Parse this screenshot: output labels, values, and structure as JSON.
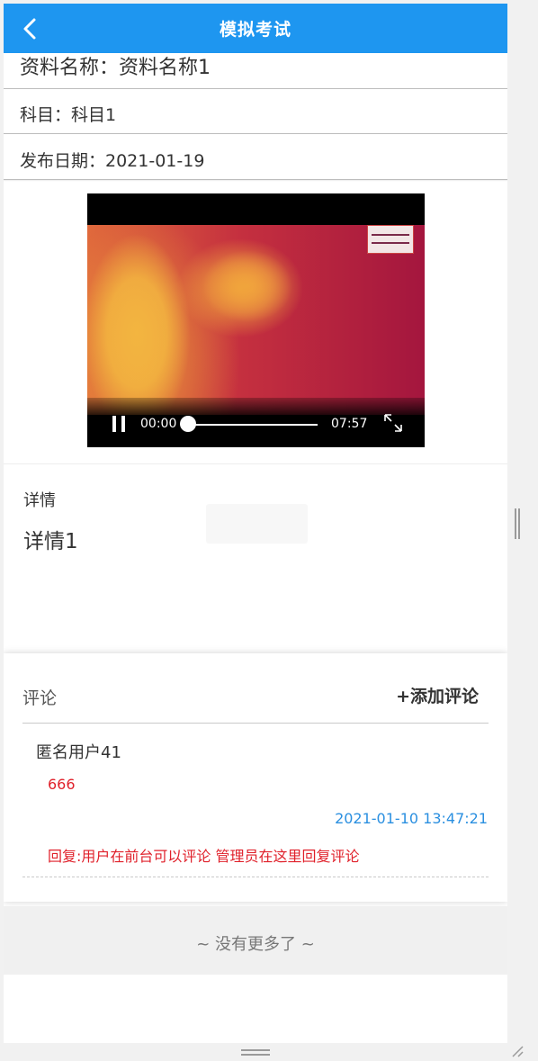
{
  "header": {
    "title": "模拟考试",
    "back_icon": "chevron-left-icon"
  },
  "info": {
    "name": "资料名称：资料名称1",
    "subject": "科目：科目1",
    "publish_date": "发布日期：2021-01-19"
  },
  "video": {
    "current_time": "00:00",
    "total_time": "07:57",
    "progress": 0,
    "state": "playing",
    "pause_icon": "pause-icon",
    "fullscreen_icon": "fullscreen-icon"
  },
  "detail": {
    "label": "详情",
    "text": "详情1"
  },
  "comments": {
    "label": "评论",
    "add_label": "+添加评论",
    "items": [
      {
        "user": "匿名用户41",
        "content": "666",
        "time": "2021-01-10 13:47:21",
        "reply": "回复:用户在前台可以评论 管理员在这里回复评论"
      }
    ]
  },
  "footer": {
    "no_more": "~ 没有更多了 ~"
  },
  "colors": {
    "header_bg": "#1e96f0",
    "comment_text": "#e0212b",
    "time_text": "#2a8fe0"
  }
}
